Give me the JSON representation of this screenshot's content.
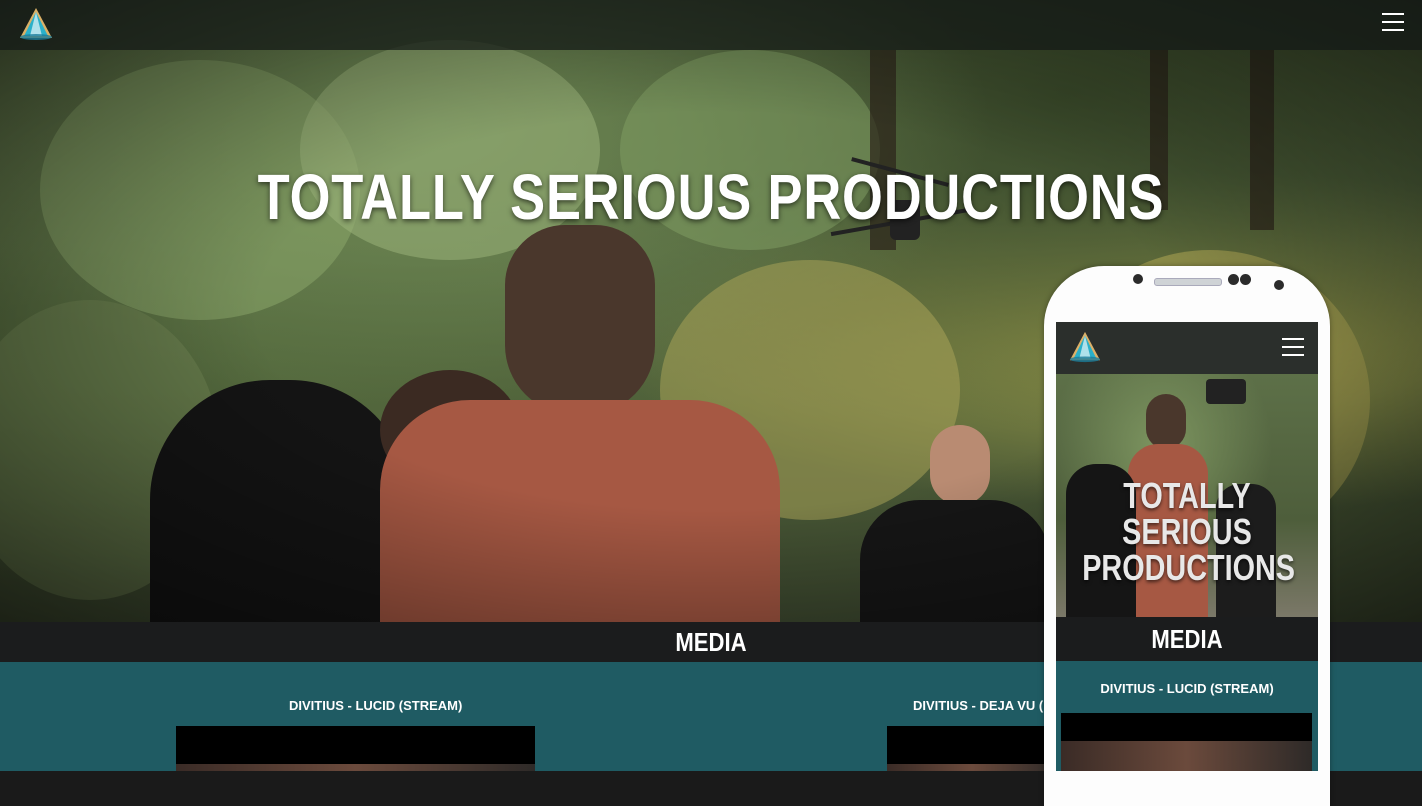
{
  "header": {
    "logo": "triangle-logo-icon",
    "menu_icon": "hamburger-menu-icon"
  },
  "hero": {
    "title": "TOTALLY SERIOUS PRODUCTIONS"
  },
  "media_section": {
    "heading": "MEDIA",
    "videos": [
      {
        "title": "DIVITIUS - LUCID (STREAM)"
      },
      {
        "title": "DIVITIUS - DEJA VU (FEAT. C"
      }
    ]
  },
  "phone_preview": {
    "logo": "triangle-logo-icon",
    "menu_icon": "hamburger-menu-icon",
    "title_line1": "TOTALLY SERIOUS",
    "title_line2": "PRODUCTIONS",
    "media_heading": "MEDIA",
    "video_title": "DIVITIUS - LUCID (STREAM)"
  },
  "colors": {
    "teal": "#1f5b63",
    "dark_band": "#1b1c1d",
    "nav_bar": "#141916"
  }
}
